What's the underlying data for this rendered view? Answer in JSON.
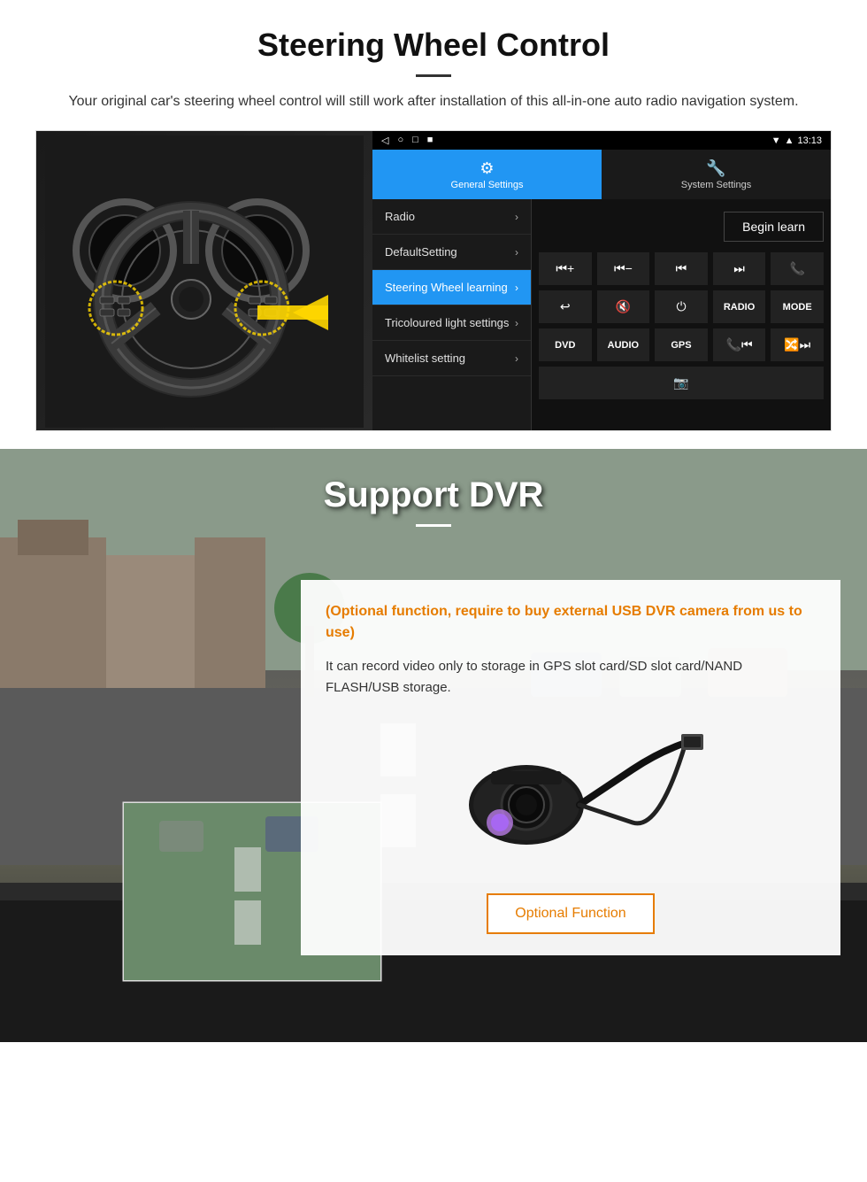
{
  "steering_section": {
    "title": "Steering Wheel Control",
    "subtitle": "Your original car's steering wheel control will still work after installation of this all-in-one auto radio navigation system.",
    "statusbar": {
      "time": "13:13",
      "signal_icon": "▼",
      "wifi_icon": "▲"
    },
    "tabs": [
      {
        "id": "general",
        "icon": "⚙",
        "label": "General Settings",
        "active": true
      },
      {
        "id": "system",
        "icon": "🔧",
        "label": "System Settings",
        "active": false
      }
    ],
    "menu_items": [
      {
        "label": "Radio",
        "active": false
      },
      {
        "label": "DefaultSetting",
        "active": false
      },
      {
        "label": "Steering Wheel learning",
        "active": true
      },
      {
        "label": "Tricoloured light settings",
        "active": false
      },
      {
        "label": "Whitelist setting",
        "active": false
      }
    ],
    "begin_learn_label": "Begin learn",
    "control_buttons": [
      [
        "⏮+",
        "⏮−",
        "⏮⏮",
        "⏭⏭",
        "📞"
      ],
      [
        "↩",
        "🔇",
        "⏻",
        "RADIO",
        "MODE"
      ],
      [
        "DVD",
        "AUDIO",
        "GPS",
        "📞⏮",
        "🔀⏭"
      ],
      [
        "📷"
      ]
    ]
  },
  "dvr_section": {
    "title": "Support DVR",
    "optional_text": "(Optional function, require to buy external USB DVR camera from us to use)",
    "description": "It can record video only to storage in GPS slot card/SD slot card/NAND FLASH/USB storage.",
    "optional_function_button": "Optional Function"
  }
}
